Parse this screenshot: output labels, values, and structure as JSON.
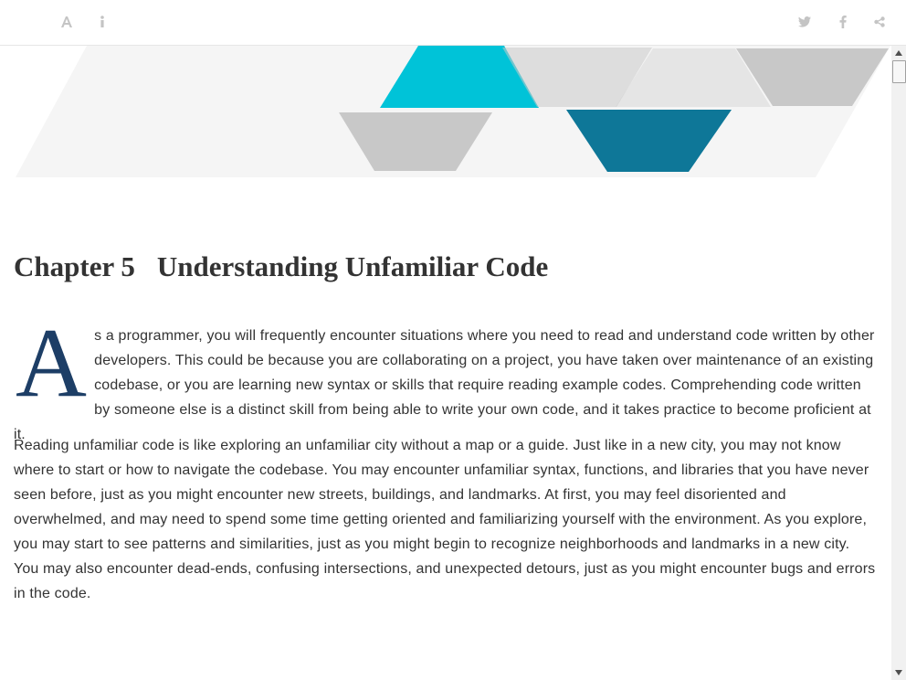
{
  "toolbar": {
    "left_icons": [
      "font-size-icon",
      "info-icon"
    ],
    "right_icons": [
      "twitter-icon",
      "facebook-icon",
      "share-icon"
    ],
    "icon_color": "#c4c4c4"
  },
  "banner": {
    "colors": {
      "light_band": "#f5f5f5",
      "cyan": "#00c3d8",
      "gray": "#c8c8c8",
      "teal": "#0e7798"
    }
  },
  "chapter": {
    "number": "Chapter 5",
    "title": "Understanding Unfamiliar Code"
  },
  "body": {
    "dropcap": "A",
    "dropcap_color": "#1d3e66",
    "paragraph1_rest": "s a programmer, you will frequently encounter situations where you need to read and understand code written by other developers. This could be because you are collaborating on a project, you have taken over maintenance of an existing codebase, or you are learning new syntax or skills that require reading example codes. Comprehending code written by someone else is a distinct skill from being able to write your own code, and it takes practice to become proficient at it.",
    "paragraph2": "Reading unfamiliar code is like exploring an unfamiliar city without a map or a guide. Just like in a new city, you may not know where to start or how to navigate the codebase. You may encounter unfamiliar syntax, functions, and libraries that you have never seen before, just as you might encounter new streets, buildings, and landmarks. At first, you may feel disoriented and overwhelmed, and may need to spend some time getting oriented and familiarizing yourself with the environment. As you explore, you may start to see patterns and similarities, just as you might begin to recognize neighborhoods and landmarks in a new city. You may also encounter dead-ends, confusing intersections, and unexpected detours, just as you might encounter bugs and errors in the code."
  }
}
